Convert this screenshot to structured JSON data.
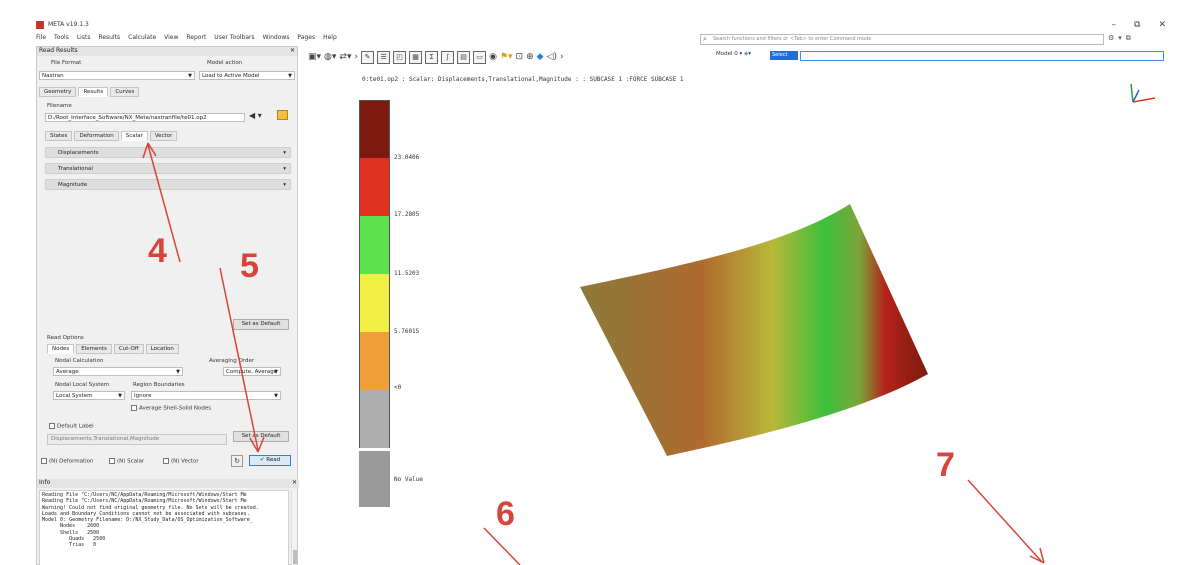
{
  "window": {
    "title": "META v19.1.3",
    "controls": [
      "–",
      "⧉",
      "✕"
    ]
  },
  "menu": [
    "File",
    "Tools",
    "Lists",
    "Results",
    "Calculate",
    "View",
    "Report",
    "User Toolbars",
    "Windows",
    "Pages",
    "Help"
  ],
  "search": {
    "placeholder": "Search functions and filters or <Tab> to enter Command mode"
  },
  "read_results": {
    "panel_title": "Read Results",
    "file_format_label": "File Format",
    "file_format_value": "Nastran",
    "model_action_label": "Model action",
    "model_action_value": "Load to Active Model",
    "top_tabs": [
      "Geometry",
      "Results",
      "Curves"
    ],
    "filename_label": "Filename",
    "filename_value": "D:/Root_Interface_Software/NX_Meta/nastranfile/te01.op2",
    "result_tabs": [
      "States",
      "Deformation",
      "Scalar",
      "Vector"
    ],
    "scalar_rows": [
      "Displacements",
      "Translational",
      "Magnitude"
    ],
    "set_default_label": "Set as Default",
    "options_title": "Read Options",
    "option_tabs": [
      "Nodes",
      "Elements",
      "Cut-Off",
      "Location"
    ],
    "nodal_calc_label": "Nodal Calculation",
    "nodal_calc_value": "Average",
    "avg_order_label": "Averaging Order",
    "avg_order_value": "Compute, Average",
    "nodal_local_label": "Nodal Local System",
    "nodal_local_value": "Local System",
    "region_label": "Region Boundaries",
    "region_value": "Ignore",
    "avg_shell_label": "Average Shell-Solid Nodes",
    "default_label_check": "Default Label",
    "default_label_value": "Displacements,Translational,Magnitude",
    "bottom_checks": [
      "(N) Deformation",
      "(N) Scalar",
      "(N) Vector"
    ],
    "read_label": "Read"
  },
  "info": {
    "title": "Info",
    "lines": [
      "Reading File \"C:/Users/NC/AppData/Roaming/Microsoft/Windows/Start Me",
      "Reading File \"C:/Users/NC/AppData/Roaming/Microsoft/Windows/Start Me",
      "Warning! Could not find original geometry file. No Sets will be created.",
      "Loads and Boundary Conditions cannot not be associated with subcases.",
      "Model 0: Geometry Filename: D:/NX_Study_Data/OS_Optimization_Software_",
      "      Nodes    2600",
      "      Shells   2500",
      "         Quads   2500",
      "         Trias   0"
    ]
  },
  "viewport": {
    "toolbar_model": "Model 0",
    "model_field": "Select",
    "title": "0:te01.op2  : Scalar: Displacements,Translational,Magnitude :  : SUBCASE 1     :FORCE SUBCASE 1"
  },
  "legend": {
    "colors": [
      "#7d1a10",
      "#e0321f",
      "#5ce34c",
      "#f2f044",
      "#ef9f39",
      "#aeaeae",
      "#9a9a9a"
    ],
    "values": [
      "23.0406",
      "17.2805",
      "11.5203",
      "5.76015",
      "<0",
      "No Value"
    ]
  },
  "callouts": [
    "4",
    "5",
    "6",
    "7"
  ]
}
